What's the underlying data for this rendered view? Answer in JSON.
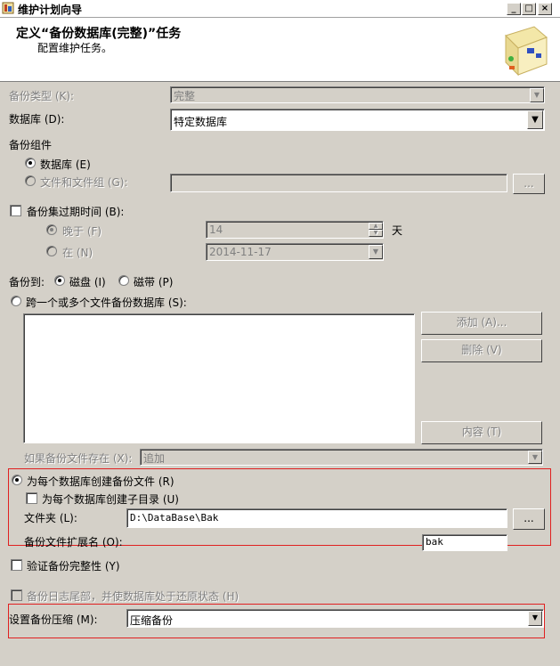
{
  "window": {
    "title": "维护计划向导",
    "buttons": {
      "min": "_",
      "max": "□",
      "close": "×"
    }
  },
  "header": {
    "title": "定义“备份数据库(完整)”任务",
    "subtitle": "配置维护任务。"
  },
  "backup_type": {
    "label": "备份类型 (K):",
    "value": "完整"
  },
  "database": {
    "label": "数据库 (D):",
    "value": "特定数据库"
  },
  "backup_component": {
    "label": "备份组件",
    "database_option": "数据库 (E)",
    "files_option": "文件和文件组 (G):",
    "browse": "..."
  },
  "expiry": {
    "label": "备份集过期时间 (B):",
    "after_label": "晚于 (F)",
    "after_value": "14",
    "unit": "天",
    "on_label": "在 (N)",
    "on_value": "2014-11-17"
  },
  "backup_to": {
    "label": "备份到:",
    "disk": "磁盘 (I)",
    "tape": "磁带 (P)"
  },
  "span_files": {
    "label": "跨一个或多个文件备份数据库 (S):",
    "add": "添加 (A)...",
    "remove": "删除 (V)",
    "contents": "内容 (T)",
    "if_exists_label": "如果备份文件存在 (X):",
    "if_exists_value": "追加"
  },
  "per_db": {
    "label": "为每个数据库创建备份文件 (R)",
    "subdir_label": "为每个数据库创建子目录 (U)",
    "folder_label": "文件夹 (L):",
    "folder_value": "D:\\DataBase\\Bak",
    "browse": "...",
    "ext_label": "备份文件扩展名 (O):",
    "ext_value": "bak"
  },
  "verify": {
    "label": "验证备份完整性 (Y)"
  },
  "tail_log": {
    "label": "备份日志尾部，并使数据库处于还原状态 (H)"
  },
  "compression": {
    "label": "设置备份压缩 (M):",
    "value": "压缩备份"
  },
  "colors": {
    "highlight": "#e02020",
    "dialog": "#d4d0c8"
  },
  "icons": [
    "wizard-app-icon",
    "wizard-graphic-icon"
  ]
}
